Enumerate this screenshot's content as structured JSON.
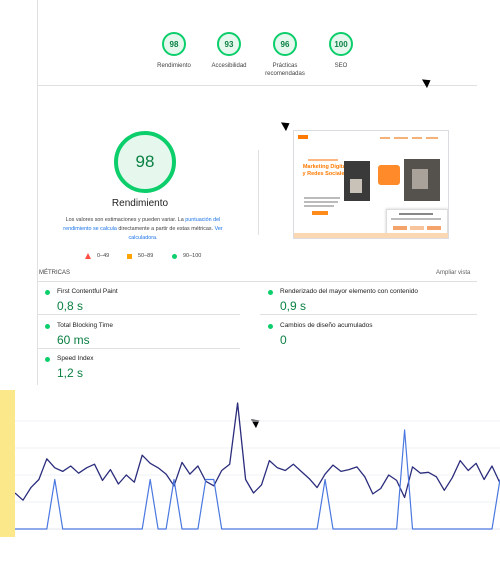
{
  "scores": [
    {
      "value": "98",
      "label": "Rendimiento"
    },
    {
      "value": "93",
      "label": "Accesibilidad"
    },
    {
      "value": "96",
      "label": "Prácticas recomendadas"
    },
    {
      "value": "100",
      "label": "SEO"
    }
  ],
  "performance": {
    "score": "98",
    "title": "Rendimiento",
    "note_before": "Los valores son estimaciones y pueden variar. La ",
    "note_link1": "puntuación del rendimiento se calcula",
    "note_middle": " directamente a partir de estas métricas. ",
    "note_link2": "Ver calculadora.",
    "colors": {
      "pass": "#0cce6b",
      "average": "#ffa400",
      "fail": "#ff4e42",
      "link": "#1a73e8"
    }
  },
  "legend": {
    "fail": "0–49",
    "average": "50–89",
    "pass": "90–100"
  },
  "preview": {
    "headline": "Marketing Digital y Redes Sociales"
  },
  "metrics_header": {
    "title": "MÉTRICAS",
    "expand": "Ampliar vista"
  },
  "metrics": [
    {
      "name": "First Contentful Paint",
      "value": "0,8 s"
    },
    {
      "name": "Renderizado del mayor elemento con contenido",
      "value": "0,9 s"
    },
    {
      "name": "Total Blocking Time",
      "value": "60 ms"
    },
    {
      "name": "Cambios de diseño acumulados",
      "value": "0"
    },
    {
      "name": "Speed Index",
      "value": "1,2 s"
    }
  ],
  "chart_data": {
    "type": "line",
    "series": [
      {
        "values": [
          40,
          32,
          46,
          55,
          78,
          68,
          64,
          70,
          62,
          68,
          72,
          54,
          66,
          50,
          60,
          52,
          82,
          73,
          68,
          61,
          48,
          74,
          61,
          70,
          53,
          48,
          65,
          72,
          140,
          55,
          40,
          49,
          76,
          68,
          65,
          72,
          64,
          56,
          46,
          61,
          71,
          64,
          66,
          69,
          58,
          39,
          45,
          60,
          54,
          35,
          69,
          62,
          63,
          58,
          43,
          57,
          76,
          65,
          73,
          55,
          70,
          51
        ]
      },
      {
        "values": [
          0,
          0,
          0,
          0,
          0,
          55,
          0,
          0,
          0,
          0,
          0,
          0,
          0,
          0,
          0,
          0,
          0,
          55,
          0,
          0,
          55,
          0,
          0,
          0,
          55,
          55,
          0,
          0,
          0,
          0,
          0,
          0,
          0,
          0,
          0,
          0,
          0,
          0,
          0,
          55,
          0,
          0,
          0,
          0,
          0,
          0,
          0,
          0,
          0,
          110,
          0,
          0,
          0,
          0,
          0,
          0,
          0,
          0,
          0,
          0,
          0,
          55
        ]
      }
    ],
    "colors": [
      "#2b2d7c",
      "#4a78e0"
    ],
    "grid": true
  }
}
